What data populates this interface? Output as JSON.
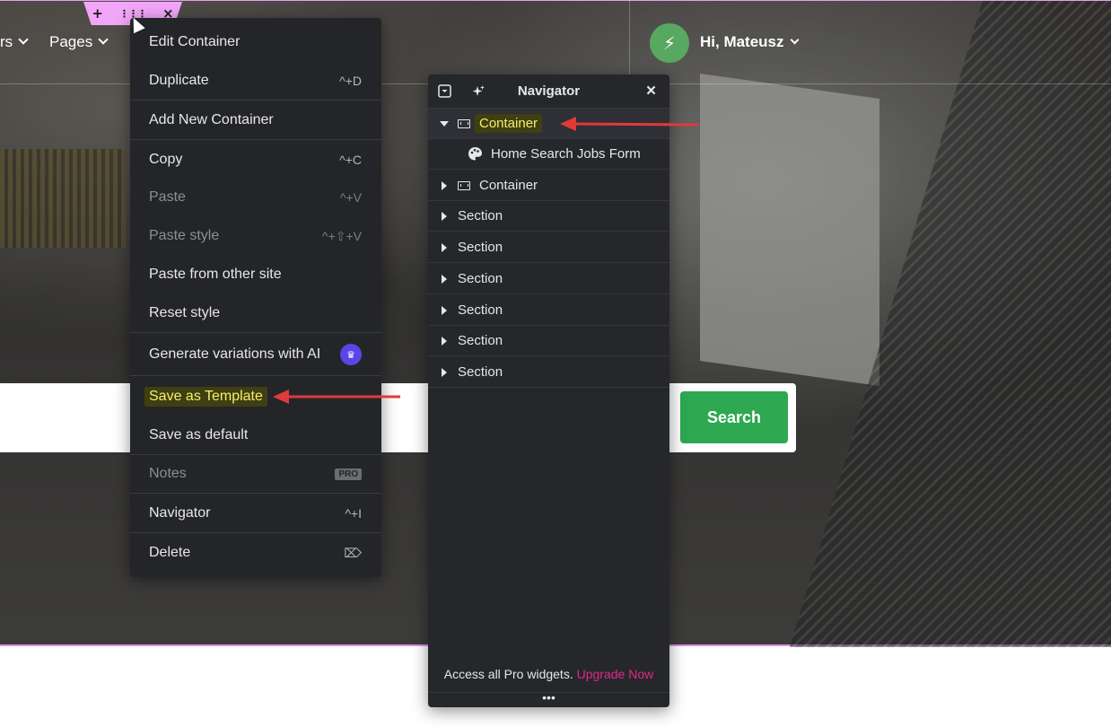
{
  "header": {
    "nav_partial": "rs",
    "nav_pages": "Pages",
    "user_greeting": "Hi, Mateusz",
    "avatar_glyph": "⚡"
  },
  "handle": {
    "add": "+",
    "drag": "⋮⋮⋮",
    "close": "×"
  },
  "context_menu": {
    "items": [
      {
        "label": "Edit Container",
        "shortcut": ""
      },
      {
        "label": "Duplicate",
        "shortcut": "^+D"
      },
      {
        "label": "Add New Container",
        "shortcut": ""
      },
      {
        "label": "Copy",
        "shortcut": "^+C"
      },
      {
        "label": "Paste",
        "shortcut": "^+V"
      },
      {
        "label": "Paste style",
        "shortcut": "^+⇧+V"
      },
      {
        "label": "Paste from other site",
        "shortcut": ""
      },
      {
        "label": "Reset style",
        "shortcut": ""
      },
      {
        "label": "Generate variations with AI",
        "shortcut": ""
      },
      {
        "label": "Save as Template",
        "shortcut": ""
      },
      {
        "label": "Save as default",
        "shortcut": ""
      },
      {
        "label": "Notes",
        "shortcut": ""
      },
      {
        "label": "Navigator",
        "shortcut": "^+I"
      },
      {
        "label": "Delete",
        "shortcut": "⌦"
      }
    ],
    "pro_badge": "PRO",
    "ai_badge_glyph": "♛"
  },
  "navigator": {
    "title": "Navigator",
    "close": "×",
    "rows": [
      {
        "label": "Container"
      },
      {
        "label": "Home Search Jobs Form"
      },
      {
        "label": "Container"
      },
      {
        "label": "Section"
      },
      {
        "label": "Section"
      },
      {
        "label": "Section"
      },
      {
        "label": "Section"
      },
      {
        "label": "Section"
      },
      {
        "label": "Section"
      }
    ],
    "footer_text": "Access all Pro widgets.",
    "footer_link": "Upgrade Now",
    "more": "•••"
  },
  "search": {
    "button_label": "Search"
  },
  "colors": {
    "accent_green": "#2ea851",
    "highlight_yellow": "#f4f06a",
    "arrow_red": "#e03a3a",
    "upgrade_pink": "#e0288b",
    "ai_purple": "#5a45e8"
  }
}
